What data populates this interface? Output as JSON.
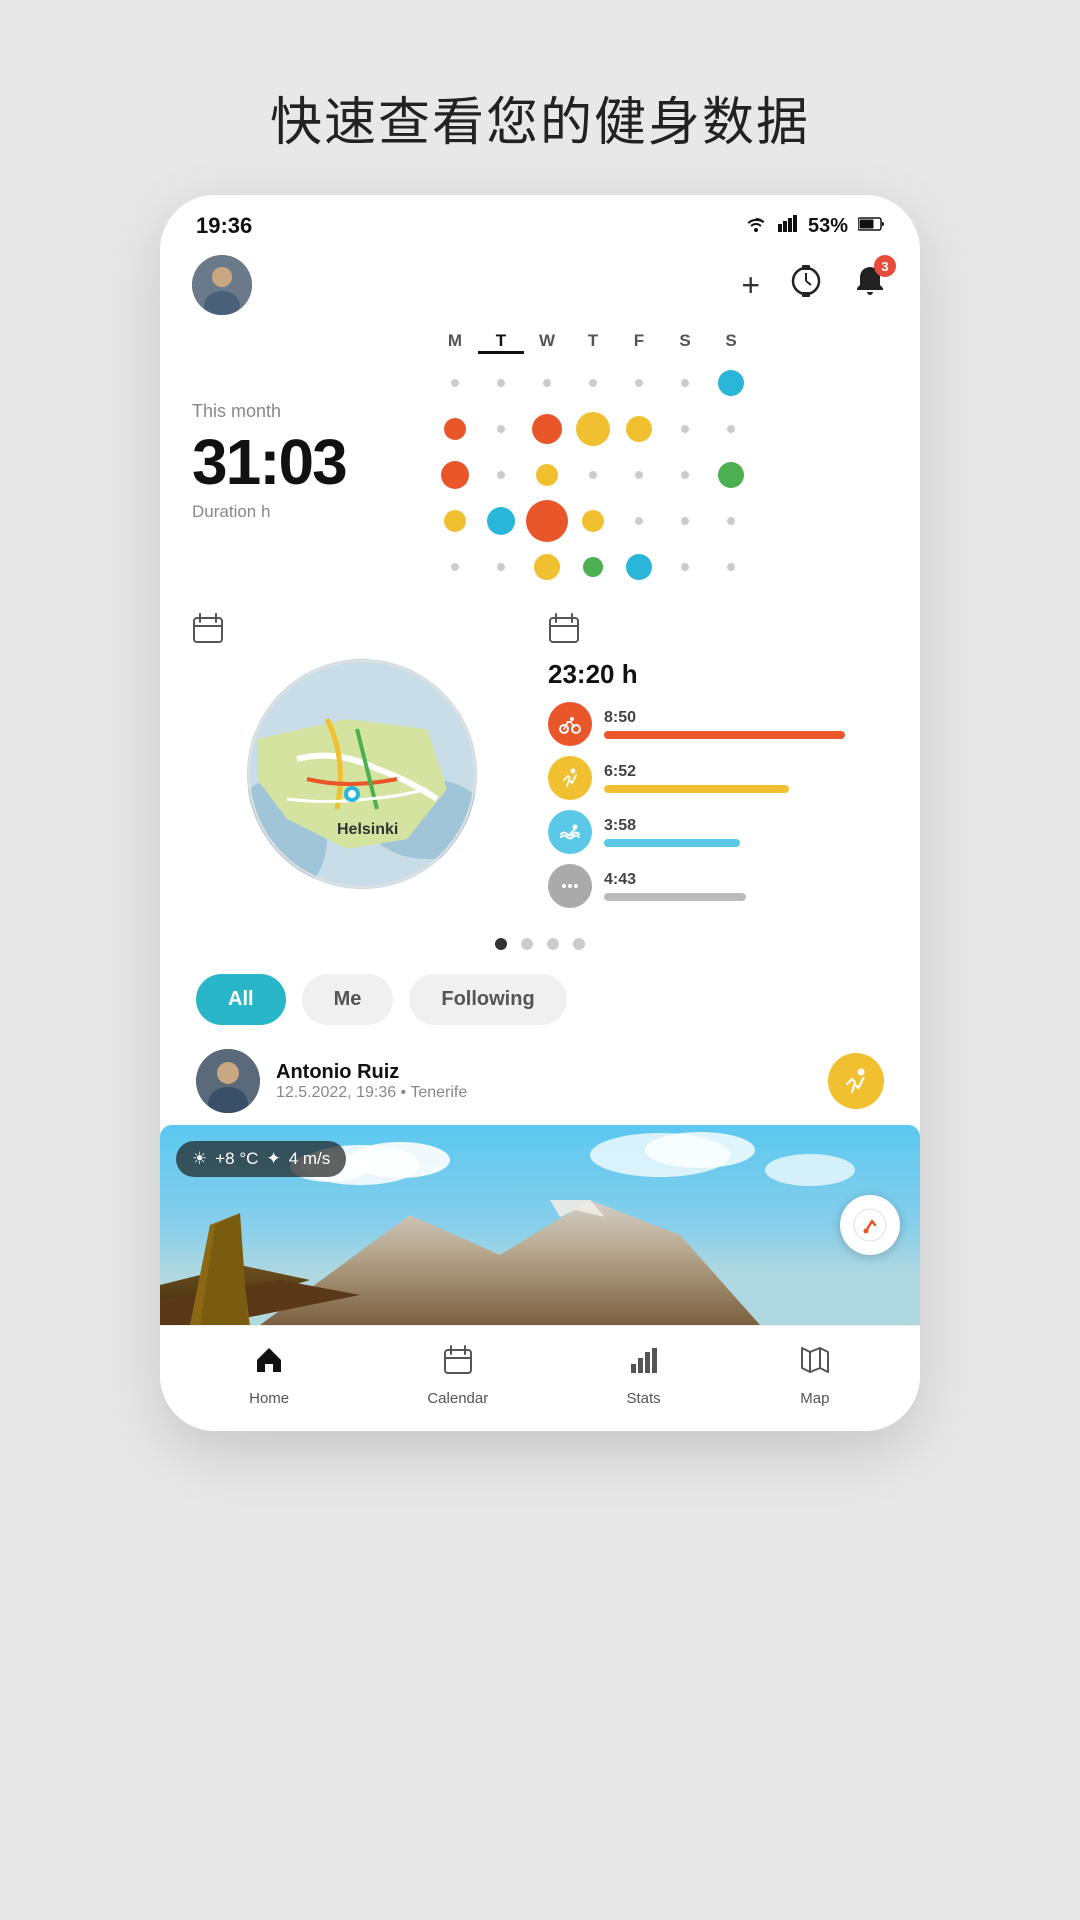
{
  "page": {
    "title": "快速查看您的健身数据",
    "bg_color": "#e8e8e8"
  },
  "status_bar": {
    "time": "19:36",
    "wifi": "wifi",
    "signal": "signal",
    "battery": "53%"
  },
  "header": {
    "add_label": "+",
    "watch_label": "⌚",
    "bell_label": "🔔",
    "notification_count": "3"
  },
  "stats": {
    "period_label": "This month",
    "time_value": "31:03",
    "duration_label": "Duration h"
  },
  "calendar": {
    "headers": [
      "M",
      "T",
      "W",
      "T",
      "F",
      "S",
      "S"
    ],
    "active_header_index": 1
  },
  "activity_summary": {
    "calendar_icon": "📅",
    "total_time": "23:20 h",
    "activities": [
      {
        "icon": "🚴",
        "color": "#e8562a",
        "time": "8:50",
        "bar_width": "85%",
        "bar_color": "#e8562a"
      },
      {
        "icon": "🏃",
        "color": "#f0c030",
        "time": "6:52",
        "bar_width": "65%",
        "bar_color": "#f0c030"
      },
      {
        "icon": "🏊",
        "color": "#5bc8e8",
        "time": "3:58",
        "bar_width": "48%",
        "bar_color": "#5bc8e8"
      },
      {
        "icon": "···",
        "color": "#aaa",
        "time": "4:43",
        "bar_width": "50%",
        "bar_color": "#bbb"
      }
    ]
  },
  "map": {
    "icon": "📅",
    "city_label": "Helsinki"
  },
  "pagination": {
    "dots": [
      true,
      false,
      false,
      false
    ]
  },
  "filters": {
    "tabs": [
      "All",
      "Me",
      "Following"
    ],
    "active_index": 0
  },
  "feed_item": {
    "name": "Antonio Ruiz",
    "meta": "12.5.2022, 19:36 • Tenerife",
    "activity_type": "running"
  },
  "weather": {
    "temp": "+8 °C",
    "wind": "4 m/s"
  },
  "bottom_nav": {
    "items": [
      {
        "label": "Home",
        "icon": "home",
        "active": true
      },
      {
        "label": "Calendar",
        "icon": "calendar",
        "active": false
      },
      {
        "label": "Stats",
        "icon": "stats",
        "active": false
      },
      {
        "label": "Map",
        "icon": "map",
        "active": false
      }
    ]
  }
}
